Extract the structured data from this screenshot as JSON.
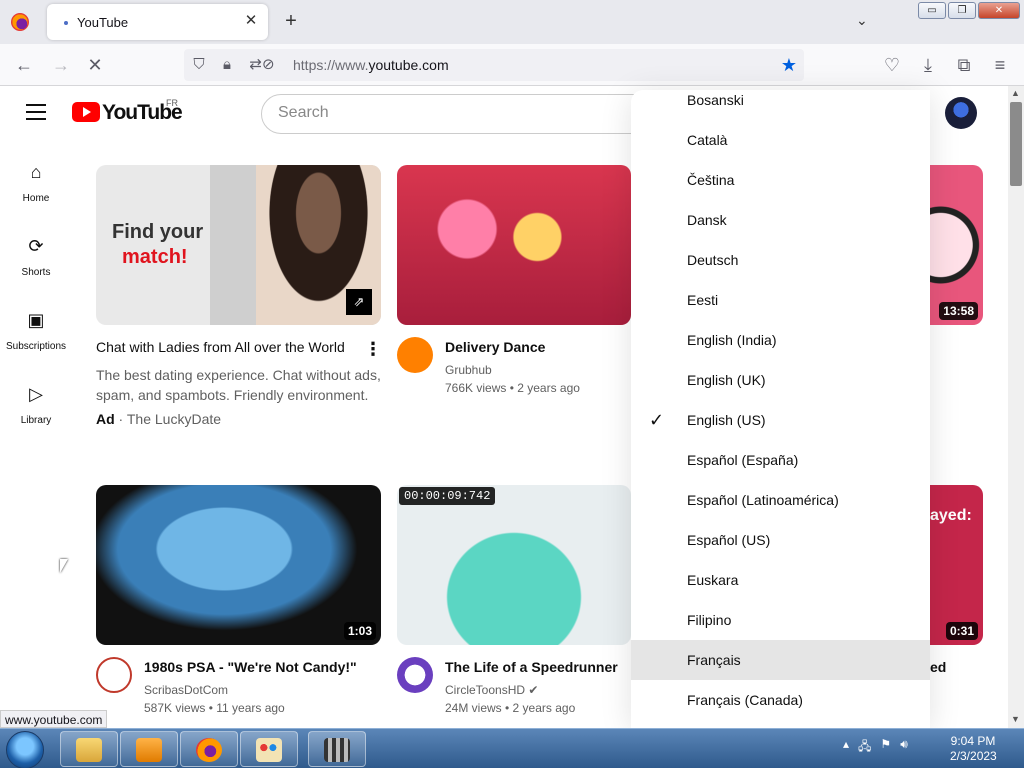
{
  "browser": {
    "tab_title": "YouTube",
    "new_tab_label": "+",
    "url_prefix": "https://www.",
    "url_domain": "youtube.com",
    "status_url": "www.youtube.com"
  },
  "youtube": {
    "logo_text": "YouTube",
    "region": "FR",
    "search_placeholder": "Search"
  },
  "sidebar": {
    "items": [
      {
        "label": "Home",
        "icon": "home-icon"
      },
      {
        "label": "Shorts",
        "icon": "shorts-icon"
      },
      {
        "label": "Subscriptions",
        "icon": "subscriptions-icon"
      },
      {
        "label": "Library",
        "icon": "library-icon"
      }
    ]
  },
  "videos": {
    "ad": {
      "thumb_line1": "Find your",
      "thumb_line2": "match!",
      "title": "Chat with Ladies from All over the World",
      "description": "The best dating experience. Chat without ads, spam, and spambots. Friendly environment.",
      "ad_label": "Ad",
      "separator": " · ",
      "advertiser": "The LuckyDate"
    },
    "delivery": {
      "title": "Delivery Dance",
      "channel": "Grubhub",
      "meta": "766K views • 2 years ago"
    },
    "candy": {
      "title": "1980s PSA - \"We're Not Candy!\"",
      "channel": "ScribasDotCom",
      "meta": "587K views • 11 years ago",
      "duration": "1:03"
    },
    "speedrunner": {
      "title": "The Life of a Speedrunner",
      "channel": "CircleToonsHD",
      "meta": "24M views • 2 years ago",
      "timestamp": "00:00:09:742"
    },
    "partial_top": {
      "duration": "13:58"
    },
    "partial_bottom": {
      "duration": "0:31",
      "thumb_text": "ayed:",
      "title_tail": "ed"
    }
  },
  "language_menu": {
    "items": [
      "Bosanski",
      "Català",
      "Čeština",
      "Dansk",
      "Deutsch",
      "Eesti",
      "English (India)",
      "English (UK)",
      "English (US)",
      "Español (España)",
      "Español (Latinoamérica)",
      "Español (US)",
      "Euskara",
      "Filipino",
      "Français",
      "Français (Canada)"
    ],
    "checked": "English (US)",
    "hovered": "Français"
  },
  "taskbar": {
    "time": "9:04 PM",
    "date": "2/3/2023"
  },
  "colors": {
    "yt_red": "#ff0000",
    "star_blue": "#0060df",
    "menu_hover": "#e5e5e5"
  }
}
